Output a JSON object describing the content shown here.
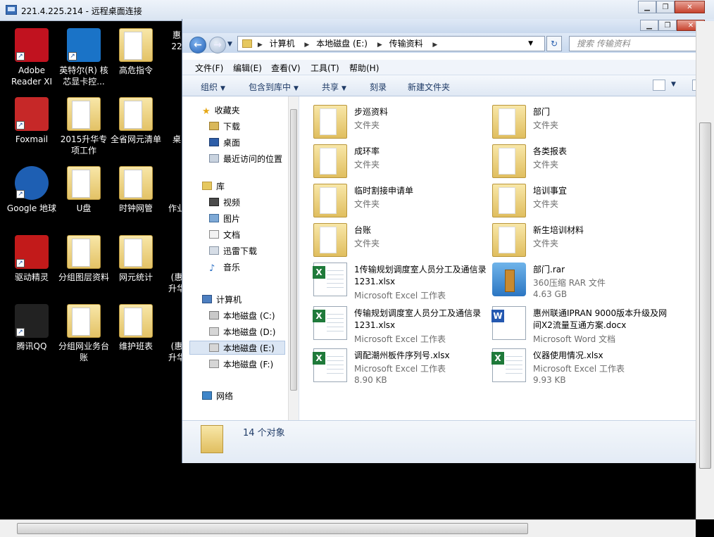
{
  "rdp": {
    "title": "221.4.225.214 - 远程桌面连接"
  },
  "desktop": {
    "icons": [
      {
        "label": "Adobe Reader XI",
        "icon": "adobe-reader-icon"
      },
      {
        "label": "英特尔(R) 核芯显卡控...",
        "icon": "intel-graphics-icon"
      },
      {
        "label": "高危指令",
        "icon": "folder-icon"
      },
      {
        "label": "Foxmail",
        "icon": "foxmail-icon"
      },
      {
        "label": "2015升华专项工作",
        "icon": "folder-icon"
      },
      {
        "label": "全省网元清单",
        "icon": "folder-icon"
      },
      {
        "label": "Google 地球",
        "icon": "google-earth-icon"
      },
      {
        "label": "U盘",
        "icon": "folder-icon"
      },
      {
        "label": "时钟网管",
        "icon": "folder-icon"
      },
      {
        "label": "驱动精灵",
        "icon": "driver-genius-icon"
      },
      {
        "label": "分组图层资料",
        "icon": "folder-icon"
      },
      {
        "label": "网元统计",
        "icon": "folder-icon"
      },
      {
        "label": "腾讯QQ",
        "icon": "qq-icon"
      },
      {
        "label": "分组网业务台账",
        "icon": "folder-icon"
      },
      {
        "label": "维护班表",
        "icon": "folder-icon"
      }
    ],
    "partial_labels": [
      "惠 22",
      "桌",
      "作业",
      "(惠 升华",
      "(惠 升华"
    ]
  },
  "explorer": {
    "address": [
      "计算机",
      "本地磁盘 (E:)",
      "传输资料"
    ],
    "search_placeholder": "搜索 传输资料",
    "menu": [
      "文件(F)",
      "编辑(E)",
      "查看(V)",
      "工具(T)",
      "帮助(H)"
    ],
    "commands": [
      "组织",
      "包含到库中",
      "共享",
      "刻录",
      "新建文件夹"
    ],
    "nav": {
      "favorites": "收藏夹",
      "favorites_items": [
        "下载",
        "桌面",
        "最近访问的位置"
      ],
      "library": "库",
      "library_items": [
        "视频",
        "图片",
        "文档",
        "迅雷下载",
        "音乐"
      ],
      "computer": "计算机",
      "drives": [
        "本地磁盘 (C:)",
        "本地磁盘 (D:)",
        "本地磁盘 (E:)",
        "本地磁盘 (F:)"
      ],
      "network": "网络"
    },
    "files": [
      {
        "name": "步巡资料",
        "type": "文件夹",
        "size": "",
        "kind": "folder"
      },
      {
        "name": "部门",
        "type": "文件夹",
        "size": "",
        "kind": "folder"
      },
      {
        "name": "成环率",
        "type": "文件夹",
        "size": "",
        "kind": "folder"
      },
      {
        "name": "各类报表",
        "type": "文件夹",
        "size": "",
        "kind": "folder"
      },
      {
        "name": "临时割接申请单",
        "type": "文件夹",
        "size": "",
        "kind": "folder"
      },
      {
        "name": "培训事宜",
        "type": "文件夹",
        "size": "",
        "kind": "folder"
      },
      {
        "name": "台账",
        "type": "文件夹",
        "size": "",
        "kind": "folder"
      },
      {
        "name": "新生培训材料",
        "type": "文件夹",
        "size": "",
        "kind": "folder"
      },
      {
        "name": "1传输规划调度室人员分工及通信录1231.xlsx",
        "type": "Microsoft Excel 工作表",
        "size": "",
        "kind": "xls"
      },
      {
        "name": "部门.rar",
        "type": "360压缩 RAR 文件",
        "size": "4.63 GB",
        "kind": "rar"
      },
      {
        "name": "传输规划调度室人员分工及通信录1231.xlsx",
        "type": "Microsoft Excel 工作表",
        "size": "",
        "kind": "xls"
      },
      {
        "name": "惠州联通IPRAN 9000版本升级及网间X2流量互通方案.docx",
        "type": "Microsoft Word 文档",
        "size": "",
        "kind": "doc"
      },
      {
        "name": "调配潮州板件序列号.xlsx",
        "type": "Microsoft Excel 工作表",
        "size": "8.90 KB",
        "kind": "xls"
      },
      {
        "name": "仪器使用情况.xlsx",
        "type": "Microsoft Excel 工作表",
        "size": "9.93 KB",
        "kind": "xls"
      }
    ],
    "status": "14 个对象"
  }
}
